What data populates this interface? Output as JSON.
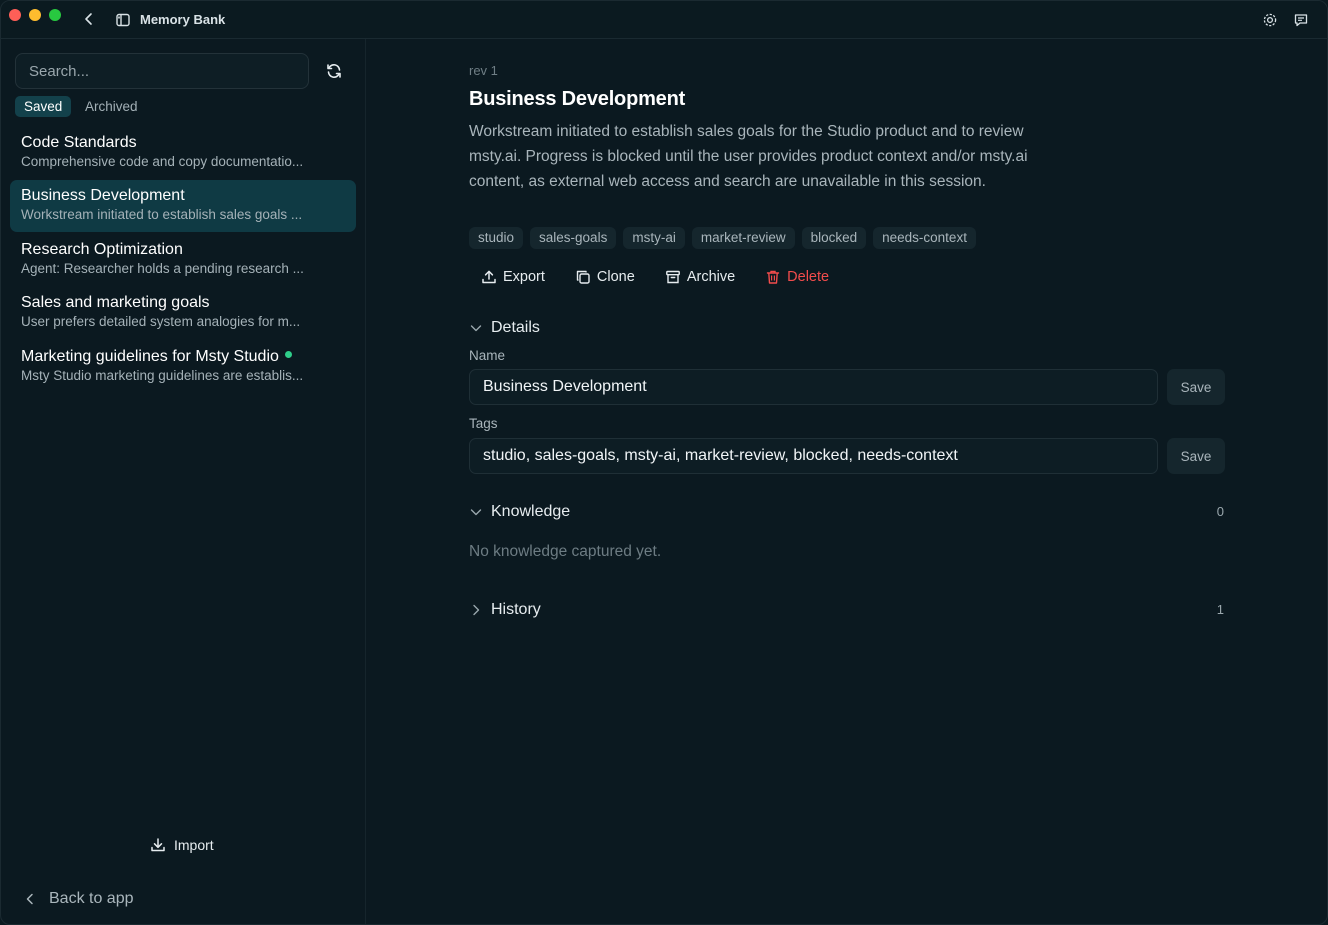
{
  "window": {
    "title": "Memory Bank"
  },
  "icons": {
    "back": "chevron-left-icon",
    "sidebar": "sidebar-toggle-icon",
    "settings": "gear-icon",
    "feedback": "chat-icon"
  },
  "colors": {
    "accent": "#0f3a44",
    "danger": "#f24c4c",
    "online": "#2fce8a"
  },
  "sidebar": {
    "search_placeholder": "Search...",
    "tabs": {
      "saved": "Saved",
      "archived": "Archived"
    },
    "items": [
      {
        "title": "Code Standards",
        "subtitle": "Comprehensive code and copy documentatio..."
      },
      {
        "title": "Business Development",
        "subtitle": "Workstream initiated to establish sales goals ..."
      },
      {
        "title": "Research Optimization",
        "subtitle": "Agent: Researcher holds a pending research ..."
      },
      {
        "title": "Sales and marketing goals",
        "subtitle": "User prefers detailed system analogies for m..."
      },
      {
        "title": "Marketing guidelines for Msty Studio",
        "subtitle": "Msty Studio marketing guidelines are establis..."
      }
    ],
    "import_label": "Import",
    "back_label": "Back to app"
  },
  "detail": {
    "rev": "rev 1",
    "title": "Business Development",
    "description": "Workstream initiated to establish sales goals for the Studio product and to review msty.ai. Progress is blocked until the user provides product context and/or msty.ai content, as external web access and search are unavailable in this session.",
    "tags": [
      "studio",
      "sales-goals",
      "msty-ai",
      "market-review",
      "blocked",
      "needs-context"
    ],
    "actions": {
      "export": "Export",
      "clone": "Clone",
      "archive": "Archive",
      "delete": "Delete"
    },
    "details": {
      "heading": "Details",
      "name_label": "Name",
      "name_value": "Business Development",
      "tags_label": "Tags",
      "tags_value": "studio, sales-goals, msty-ai, market-review, blocked, needs-context",
      "save_label": "Save"
    },
    "knowledge": {
      "heading": "Knowledge",
      "count": "0",
      "empty": "No knowledge captured yet."
    },
    "history": {
      "heading": "History",
      "count": "1"
    }
  }
}
